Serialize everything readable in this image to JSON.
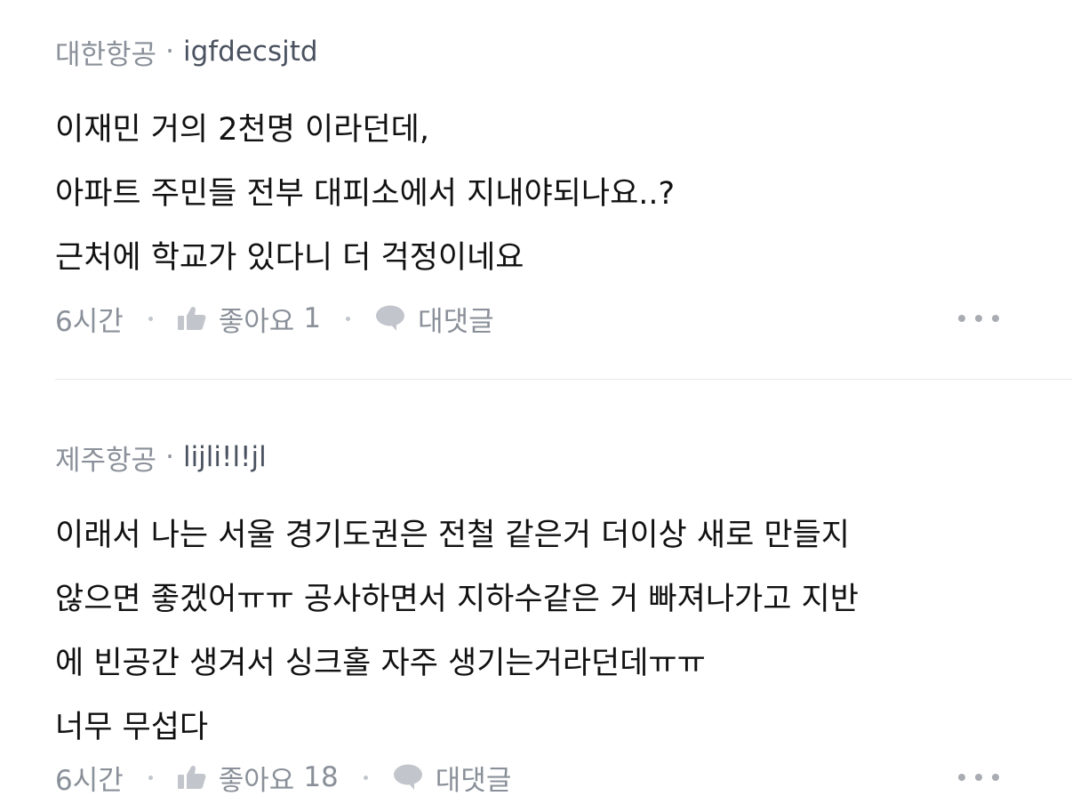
{
  "comments": [
    {
      "company": "대한항공",
      "separator": "·",
      "username": "igfdecsjtd",
      "text": "이재민 거의 2천명 이라던데,\n아파트 주민들 전부 대피소에서 지내야되나요..?\n근처에 학교가 있다니 더 걱정이네요",
      "time": "6시간",
      "like_label": "좋아요",
      "like_count": "1",
      "reply_label": "대댓글"
    },
    {
      "company": "제주항공",
      "separator": "·",
      "username": "lijli!l!jl",
      "text": "이래서 나는 서울 경기도권은 전철 같은거 더이상 새로 만들지\n않으면 좋겠어ㅠㅠ 공사하면서 지하수같은 거 빠져나가고 지반\n에 빈공간 생겨서 싱크홀 자주 생기는거라던데ㅠㅠ\n너무 무섭다",
      "time": "6시간",
      "like_label": "좋아요",
      "like_count": "18",
      "reply_label": "대댓글"
    }
  ],
  "icons": {
    "like": "thumbs-up-icon",
    "reply": "speech-bubble-icon",
    "more": "more-dots-icon"
  },
  "colors": {
    "meta_text": "#8a9099",
    "username": "#4a5260",
    "body_text": "#111111",
    "icon": "#c2c6cc",
    "divider": "#e6e8eb"
  }
}
